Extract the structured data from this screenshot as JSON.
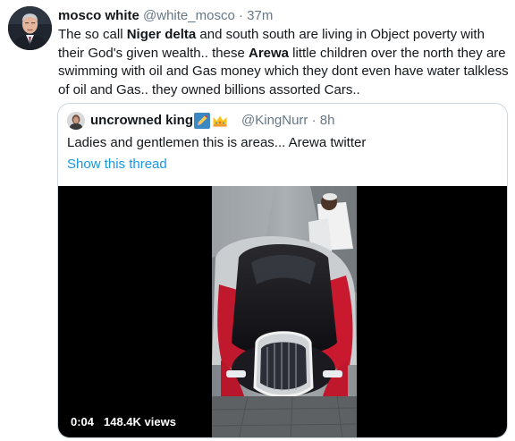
{
  "tweet": {
    "display_name": "mosco white",
    "handle": "@white_mosco",
    "separator": "·",
    "time": "37m",
    "body": {
      "part1": "The so call ",
      "bold1": "Niger delta",
      "part2": " and south south are living in Object poverty with their God's given wealth.. these ",
      "bold2": "Arewa",
      "part3": " little children over the north they are swimming with oil and Gas money which they dont even have water talkless of oil and Gas.. they owned billions assorted Cars.."
    }
  },
  "quoted_tweet": {
    "display_name": "uncrowned king",
    "name_icons": [
      "pencil-emoji-icon",
      "crown-emoji-icon"
    ],
    "handle": "@KingNurr",
    "separator": "·",
    "time": "8h",
    "text": "Ladies and gentlemen this is areas... Arewa twitter",
    "show_thread": "Show this thread"
  },
  "video": {
    "elapsed": "0:04",
    "views": "148.4K views"
  },
  "colors": {
    "text": "#14171a",
    "secondary": "#657786",
    "link": "#1b95e0",
    "border": "#ccd6dd"
  }
}
